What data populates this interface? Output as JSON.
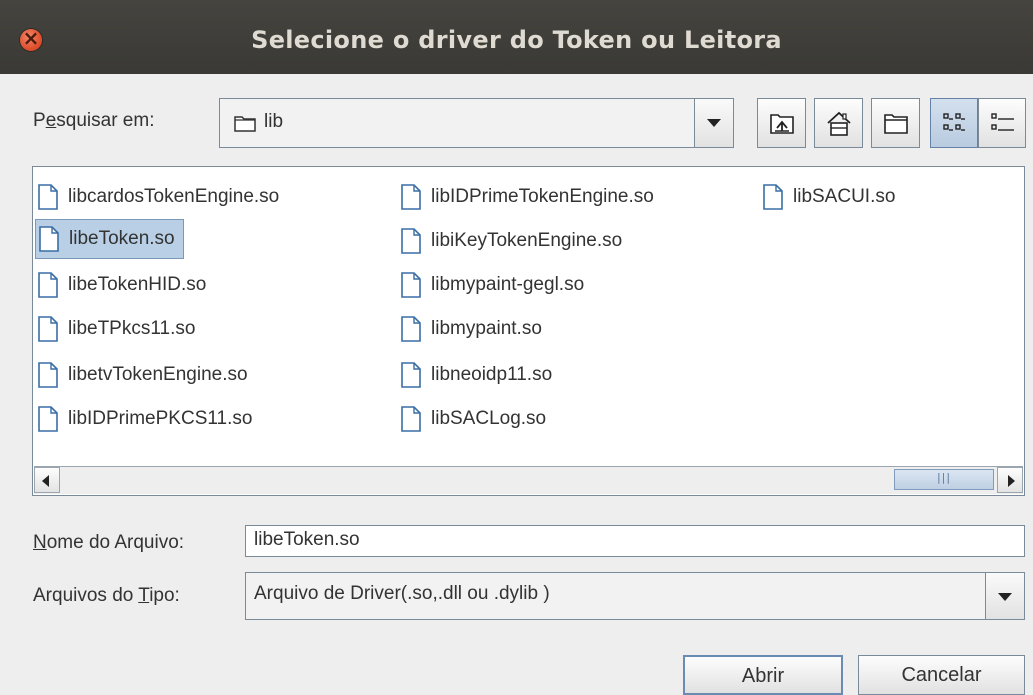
{
  "window": {
    "title": "Selecione o driver do Token ou Leitora"
  },
  "look_in": {
    "label_pre": "P",
    "label_u": "e",
    "label_post": "squisar em:",
    "value": "lib"
  },
  "toolbar": {
    "up_icon": "up-folder-icon",
    "home_icon": "home-icon",
    "new_folder_icon": "new-folder-icon",
    "list_icon": "list-view-icon",
    "details_icon": "details-view-icon"
  },
  "files": [
    {
      "name": "libcardosTokenEngine.so"
    },
    {
      "name": "libeToken.so"
    },
    {
      "name": "libeTokenHID.so"
    },
    {
      "name": "libeTPkcs11.so"
    },
    {
      "name": "libetvTokenEngine.so"
    },
    {
      "name": "libIDPrimePKCS11.so"
    },
    {
      "name": "libIDPrimeTokenEngine.so"
    },
    {
      "name": "libiKeyTokenEngine.so"
    },
    {
      "name": "libmypaint-gegl.so"
    },
    {
      "name": "libmypaint.so"
    },
    {
      "name": "libneoidp11.so"
    },
    {
      "name": "libSACLog.so"
    },
    {
      "name": "libSACUI.so"
    }
  ],
  "selected_file": "libeToken.so",
  "file_name": {
    "label_u": "N",
    "label_post": "ome do Arquivo:",
    "value": "libeToken.so"
  },
  "file_type": {
    "label_pre": "Arquivos do ",
    "label_u": "T",
    "label_post": "ipo:",
    "value": "Arquivo de Driver(.so,.dll ou .dylib )"
  },
  "buttons": {
    "open": "Abrir",
    "cancel": "Cancelar"
  }
}
